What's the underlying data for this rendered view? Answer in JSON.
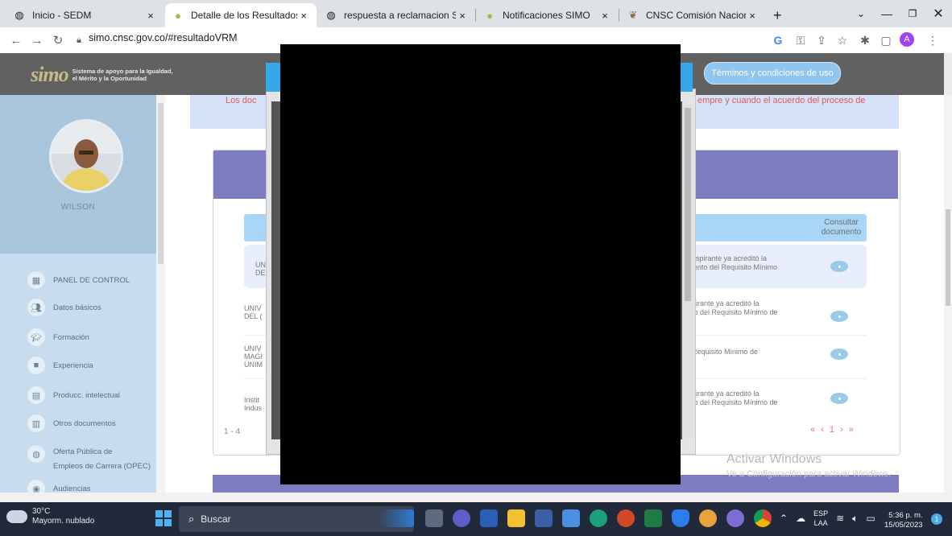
{
  "browser": {
    "tabs": [
      {
        "title": "Inicio - SEDM",
        "icon": "globe-icon"
      },
      {
        "title": "Detalle de los Resultados de",
        "icon": "leaf-icon",
        "active": true
      },
      {
        "title": "respuesta a reclamacion SIM",
        "icon": "globe-icon"
      },
      {
        "title": "Notificaciones SIMO",
        "icon": "leaf-icon"
      },
      {
        "title": "CNSC Comisión Nacional de",
        "icon": "cnsc-icon"
      }
    ],
    "new_tab": "+",
    "close": "×",
    "url": "simo.cnsc.gov.co/#resultadoVRM",
    "profile_initial": "A"
  },
  "app": {
    "logo_text": "simo",
    "logo_tagline_1": "Sistema de apoyo para la Igualdad,",
    "logo_tagline_2": "el Mérito y la Oportunidad",
    "terms_button": "Términos y condiciones de uso"
  },
  "sidebar": {
    "user_name": "WILSON",
    "items": [
      {
        "label": "PANEL DE CONTROL",
        "icon": "dashboard-icon"
      },
      {
        "label": "Datos básicos",
        "icon": "people-icon"
      },
      {
        "label": "Formación",
        "icon": "graduation-icon"
      },
      {
        "label": "Experiencia",
        "icon": "briefcase-icon"
      },
      {
        "label": "Producc. intelectual",
        "icon": "book-icon"
      },
      {
        "label": "Otros documentos",
        "icon": "document-icon"
      },
      {
        "label": "Oferta Pública de",
        "label2": "Empleos de Carrera (OPEC)",
        "icon": "globe-icon"
      },
      {
        "label": "Audiencias",
        "icon": "audience-icon"
      }
    ]
  },
  "main": {
    "notice_left": "Los doc",
    "notice_right": "empre y cuando el acuerdo del proceso de",
    "table": {
      "doc_header": "Consultar documento",
      "rows": [
        {
          "left_1": "UN",
          "left_2": "DE",
          "right_1": "aspirante ya acreditó la",
          "right_2": "iento del Requisito Mínimo"
        },
        {
          "left_1": "UNIV",
          "left_2": "DEL (",
          "right_1": "pirante ya acreditó la",
          "right_2": "to del Requisito Mínimo de"
        },
        {
          "left_1": "UNIV",
          "left_2": "MAGI",
          "left_3": "UNIM",
          "right_1": "Requisito Mínimo de",
          "right_2": ""
        },
        {
          "left_1": "Instit",
          "left_2": "Indus",
          "right_1": "pirante ya acreditó la",
          "right_2": "to del Requisito Mínimo de"
        }
      ],
      "count_text": "1 - 4",
      "pager": "« ‹ 1 › »"
    }
  },
  "watermark": {
    "line1": "Activar Windows",
    "line2": "Ve a Configuración para activar Windows."
  },
  "taskbar": {
    "temp": "30°C",
    "weather": "Mayorm. nublado",
    "search_placeholder": "Buscar",
    "lang_1": "ESP",
    "lang_2": "LAA",
    "time": "5:36 p. m.",
    "date": "15/05/2023",
    "notifications": "1"
  }
}
